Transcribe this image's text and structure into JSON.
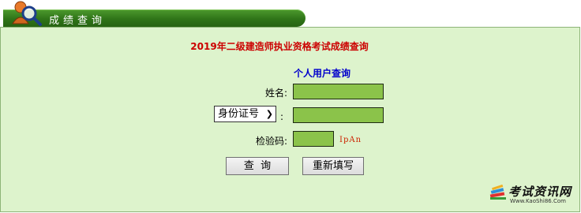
{
  "header": {
    "tab_title": "成绩查询"
  },
  "form": {
    "page_title": "2019年二级建造师执业资格考试成绩查询",
    "section_title": "个人用户查询",
    "name_label": "姓名:",
    "name_value": "",
    "id_type_selected": "身份证号",
    "id_colon": ":",
    "id_value": "",
    "captcha_label": "检验码:",
    "captcha_value": "",
    "captcha_text": "IpAn",
    "query_button": "查  询",
    "reset_button": "重新填写"
  },
  "logo": {
    "name": "考试资讯网",
    "url": "Www.KaoShi86.Com"
  },
  "colors": {
    "header_green": "#2f7418",
    "panel_bg": "#ddf3cc",
    "input_green": "#8bc34a",
    "title_red": "#cc0000",
    "section_blue": "#0000cc"
  }
}
